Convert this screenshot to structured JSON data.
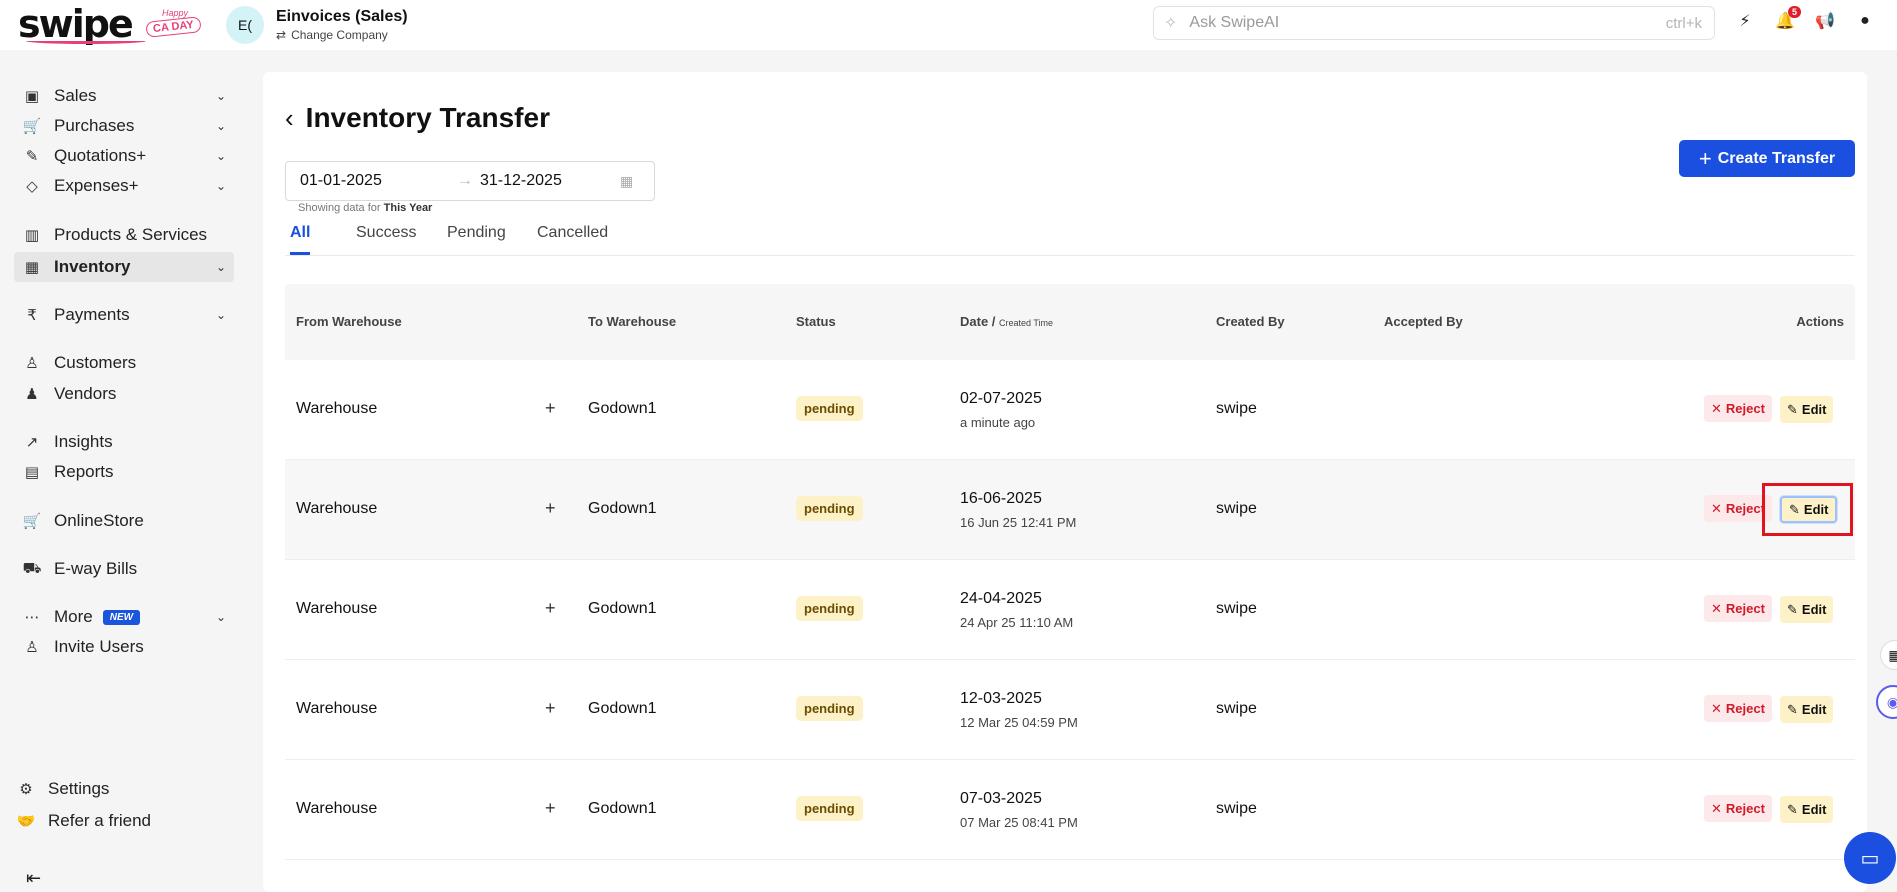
{
  "brand": {
    "name": "swipe",
    "badge_top": "Happy",
    "badge_main": "CA DAY"
  },
  "company": {
    "initials": "E(",
    "name": "Einvoices (Sales)",
    "change_label": "Change Company"
  },
  "search": {
    "placeholder": "Ask SwipeAI",
    "shortcut": "ctrl+k"
  },
  "notifications": {
    "count": "5"
  },
  "sidebar": {
    "items": [
      {
        "label": "Sales"
      },
      {
        "label": "Purchases"
      },
      {
        "label": "Quotations+"
      },
      {
        "label": "Expenses+"
      },
      {
        "label": "Products & Services"
      },
      {
        "label": "Inventory"
      },
      {
        "label": "Payments"
      },
      {
        "label": "Customers"
      },
      {
        "label": "Vendors"
      },
      {
        "label": "Insights"
      },
      {
        "label": "Reports"
      },
      {
        "label": "OnlineStore"
      },
      {
        "label": "E-way Bills"
      },
      {
        "label": "More",
        "badge": "NEW"
      },
      {
        "label": "Invite Users"
      },
      {
        "label": "Settings"
      },
      {
        "label": "Refer a friend"
      }
    ]
  },
  "page": {
    "title": "Inventory Transfer",
    "date_from": "01-01-2025",
    "date_to": "31-12-2025",
    "showing_prefix": "Showing data for ",
    "showing_period": "This Year",
    "create_button": "Create Transfer"
  },
  "tabs": [
    {
      "label": "All"
    },
    {
      "label": "Success"
    },
    {
      "label": "Pending"
    },
    {
      "label": "Cancelled"
    }
  ],
  "table": {
    "headers": {
      "from": "From Warehouse",
      "to": "To Warehouse",
      "status": "Status",
      "date": "Date / ",
      "date_small": "Created Time",
      "created_by": "Created By",
      "accepted_by": "Accepted By",
      "actions": "Actions"
    },
    "reject_label": "Reject",
    "edit_label": "Edit",
    "rows": [
      {
        "from": "Warehouse",
        "to": "Godown1",
        "status": "pending",
        "date": "02-07-2025",
        "created": "a minute ago",
        "created_by": "swipe"
      },
      {
        "from": "Warehouse",
        "to": "Godown1",
        "status": "pending",
        "date": "16-06-2025",
        "created": "16 Jun 25 12:41 PM",
        "created_by": "swipe"
      },
      {
        "from": "Warehouse",
        "to": "Godown1",
        "status": "pending",
        "date": "24-04-2025",
        "created": "24 Apr 25 11:10 AM",
        "created_by": "swipe"
      },
      {
        "from": "Warehouse",
        "to": "Godown1",
        "status": "pending",
        "date": "12-03-2025",
        "created": "12 Mar 25 04:59 PM",
        "created_by": "swipe"
      },
      {
        "from": "Warehouse",
        "to": "Godown1",
        "status": "pending",
        "date": "07-03-2025",
        "created": "07 Mar 25 08:41 PM",
        "created_by": "swipe"
      }
    ]
  },
  "colors": {
    "accent": "#1a4fe0",
    "pending_bg": "#fdf1c7",
    "reject": "#d11a2a",
    "highlight": "#e0131f"
  }
}
